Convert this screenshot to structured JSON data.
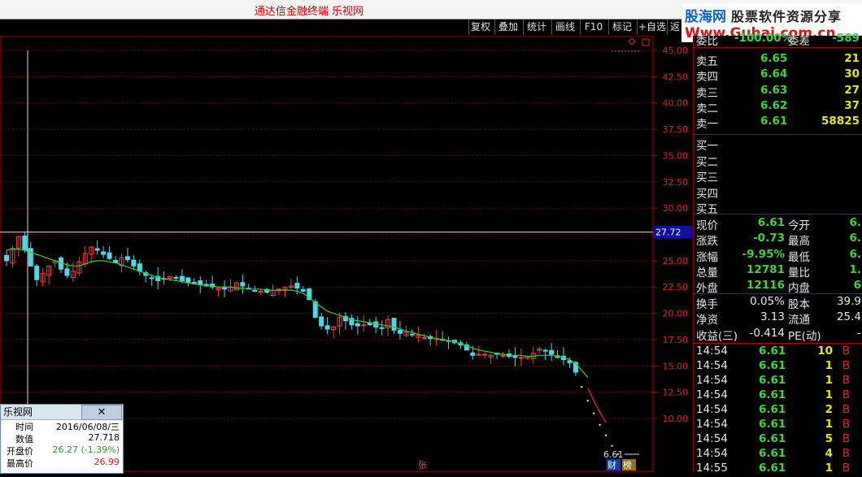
{
  "window": {
    "title": "通达信金融终端 乐视网"
  },
  "watermark": {
    "brand": "股海网",
    "slogan": "股票软件资源分享",
    "url": "Www.Guhai.com.cn"
  },
  "toolbar": {
    "buttons": [
      "复权",
      "叠加",
      "统计",
      "画线",
      "F10",
      "标记",
      "+自选",
      "返"
    ]
  },
  "chart_data": {
    "type": "candlestick",
    "yticks": [
      "45.00",
      "42.50",
      "40.00",
      "37.50",
      "35.00",
      "32.50",
      "30.00",
      "27.50",
      "25.00",
      "22.50",
      "20.00",
      "17.50",
      "15.00",
      "12.50",
      "10.00"
    ],
    "ylim": [
      7.5,
      46.5
    ],
    "crosshair_value": "27.72",
    "last_price_label": "6.61",
    "marker_zhang": "张",
    "marker_cai": "财",
    "marker_bang": "榜",
    "close_series": [
      25.0,
      26.2,
      27.3,
      26.0,
      24.5,
      23.2,
      23.8,
      24.5,
      25.0,
      24.2,
      23.6,
      24.0,
      24.9,
      25.7,
      26.3,
      26.0,
      25.6,
      25.2,
      24.8,
      25.3,
      25.1,
      24.5,
      24.0,
      23.6,
      23.3,
      23.1,
      23.3,
      23.5,
      23.4,
      23.1,
      22.9,
      22.8,
      22.7,
      22.6,
      22.5,
      22.4,
      22.3,
      22.5,
      22.9,
      22.6,
      22.3,
      22.1,
      22.1,
      22.0,
      22.2,
      22.3,
      22.5,
      22.6,
      22.4,
      22.1,
      21.3,
      19.6,
      18.8,
      18.5,
      18.7,
      19.6,
      19.3,
      18.9,
      18.8,
      18.9,
      18.9,
      18.7,
      18.6,
      19.4,
      18.4,
      18.1,
      18.2,
      18.0,
      17.9,
      17.7,
      17.6,
      17.6,
      17.5,
      17.4,
      17.2,
      17.0,
      16.5,
      16.0,
      16.1,
      16.1,
      16.0,
      16.1,
      16.0,
      15.9,
      15.8,
      15.8,
      15.9,
      16.2,
      16.6,
      16.4,
      16.1,
      15.8,
      15.6,
      15.3,
      14.4,
      13.0,
      11.7,
      10.5,
      9.4,
      8.4,
      7.4,
      6.61
    ],
    "ma_series": [
      26.0,
      26.1,
      26.1,
      26.0,
      25.8,
      25.6,
      25.4,
      25.2,
      25.0,
      24.8,
      24.6,
      24.5,
      24.5,
      24.7,
      24.9,
      25.0,
      25.0,
      24.9,
      24.8,
      24.6,
      24.4,
      24.2,
      24.0,
      23.8,
      23.6,
      23.4,
      23.3,
      23.2,
      23.1,
      23.0,
      22.9,
      22.8,
      22.7,
      22.6,
      22.6,
      22.5,
      22.5,
      22.5,
      22.4,
      22.4,
      22.3,
      22.3,
      22.3,
      22.2,
      22.2,
      22.2,
      22.2,
      22.2,
      22.1,
      21.9,
      21.5,
      21.0,
      20.6,
      20.2,
      20.0,
      19.8,
      19.6,
      19.4,
      19.3,
      19.2,
      19.1,
      19.0,
      18.9,
      18.8,
      18.7,
      18.5,
      18.3,
      18.2,
      18.0,
      17.9,
      17.7,
      17.6,
      17.5,
      17.4,
      17.3,
      17.1,
      16.9,
      16.7,
      16.5,
      16.4,
      16.3,
      16.2,
      16.1,
      16.0,
      16.0,
      16.0,
      15.9,
      15.9,
      16.0,
      16.0,
      16.0,
      15.9,
      15.8,
      15.6,
      15.2,
      14.6,
      13.9
    ]
  },
  "quote": {
    "weibi": {
      "label": "委比",
      "value": "-100.00%",
      "label2": "委差",
      "value2": "-589"
    },
    "asks": [
      {
        "label": "卖五",
        "price": "6.65",
        "vol": "21"
      },
      {
        "label": "卖四",
        "price": "6.64",
        "vol": "30"
      },
      {
        "label": "卖三",
        "price": "6.63",
        "vol": "27"
      },
      {
        "label": "卖二",
        "price": "6.62",
        "vol": "37"
      },
      {
        "label": "卖一",
        "price": "6.61",
        "vol": "58825"
      }
    ],
    "bids": [
      {
        "label": "买一"
      },
      {
        "label": "买二"
      },
      {
        "label": "买三"
      },
      {
        "label": "买四"
      },
      {
        "label": "买五"
      }
    ],
    "stats": [
      {
        "l1": "现价",
        "v1": "6.61",
        "l2": "今开",
        "v2": "6."
      },
      {
        "l1": "涨跌",
        "v1": "-0.73",
        "l2": "最高",
        "v2": "6."
      },
      {
        "l1": "涨幅",
        "v1": "-9.95%",
        "l2": "最低",
        "v2": "6."
      },
      {
        "l1": "总量",
        "v1": "12781",
        "l2": "量比",
        "v2": "1."
      },
      {
        "l1": "外盘",
        "v1": "12116",
        "l2": "内盘",
        "v2": "6"
      }
    ],
    "fund": [
      {
        "l1": "换手",
        "v1": "0.05%",
        "l2": "股本",
        "v2": "39.9"
      },
      {
        "l1": "净资",
        "v1": "3.13",
        "l2": "流通",
        "v2": "25.4"
      },
      {
        "l1": "收益(三)",
        "v1": "-0.414",
        "l2": "PE(动)",
        "v2": "-"
      }
    ],
    "ticks": [
      {
        "time": "14:54",
        "price": "6.61",
        "vol": "10",
        "side": "B"
      },
      {
        "time": "14:54",
        "price": "6.61",
        "vol": "1",
        "side": "B"
      },
      {
        "time": "14:54",
        "price": "6.61",
        "vol": "1",
        "side": "B"
      },
      {
        "time": "14:54",
        "price": "6.61",
        "vol": "1",
        "side": "B"
      },
      {
        "time": "14:54",
        "price": "6.61",
        "vol": "2",
        "side": "B"
      },
      {
        "time": "14:54",
        "price": "6.61",
        "vol": "1",
        "side": "B"
      },
      {
        "time": "14:54",
        "price": "6.61",
        "vol": "5",
        "side": "B"
      },
      {
        "time": "14:54",
        "price": "6.61",
        "vol": "4",
        "side": "B"
      },
      {
        "time": "14:55",
        "price": "6.61",
        "vol": "1",
        "side": "B"
      }
    ]
  },
  "popup": {
    "title": "乐视网",
    "close": "✕",
    "rows": [
      {
        "k": "时间",
        "v": "2016/06/08/三"
      },
      {
        "k": "数值",
        "v": "27.718"
      },
      {
        "k": "开盘价",
        "v": "26.27 (-1.39%)"
      },
      {
        "k": "最高价",
        "v": "26.99"
      }
    ]
  }
}
